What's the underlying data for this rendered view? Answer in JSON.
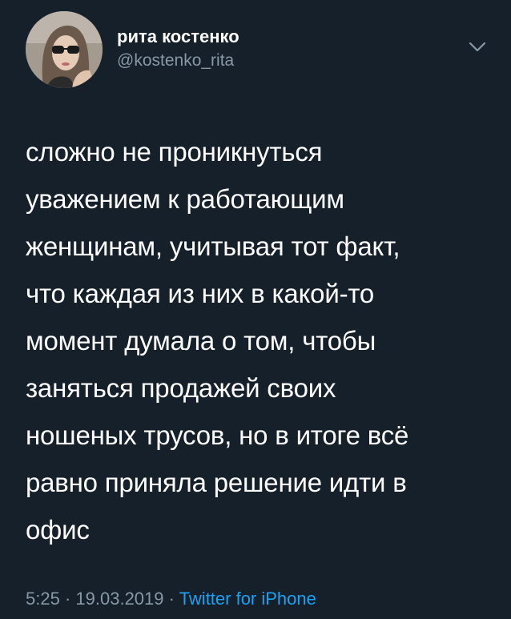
{
  "author": {
    "display_name": "рита костенко",
    "handle": "@kostenko_rita"
  },
  "icons": {
    "avatar": "profile-photo",
    "menu": "chevron-down-icon"
  },
  "tweet": {
    "text": "сложно не проникнуться\nуважением к работающим\nженщинам, учитывая тот факт,\nчто каждая из них в какой-то\nмомент думала о том, чтобы\nзаняться продажей своих\nношеных трусов, но в итоге всё\nравно приняла решение идти в\nофис"
  },
  "meta": {
    "time": "5:25",
    "separator": "·",
    "date": "19.03.2019",
    "source": "Twitter for iPhone"
  },
  "colors": {
    "background": "#15202b",
    "text": "#ffffff",
    "secondary": "#8899a6",
    "link": "#1da1f2"
  }
}
